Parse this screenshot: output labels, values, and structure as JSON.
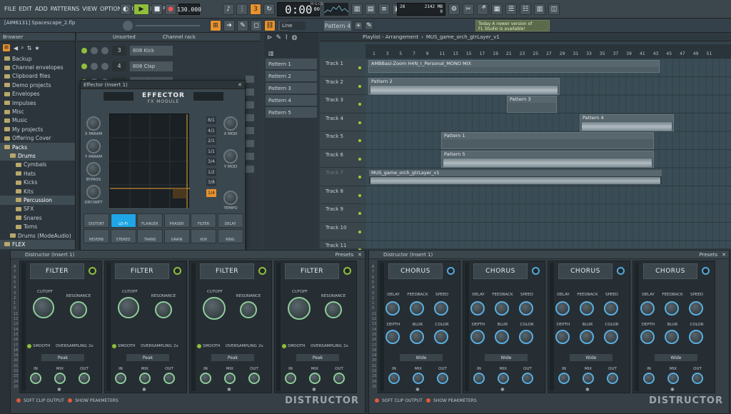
{
  "menu": [
    "FILE",
    "EDIT",
    "ADD",
    "PATTERNS",
    "VIEW",
    "OPTIONS",
    "TOOLS",
    "HELP"
  ],
  "transport": {
    "tempo": "130.000",
    "time": "0:00",
    "time_sub": "00",
    "time_unit": "M:S:CS",
    "cpu": "28",
    "mem": "2142 MB",
    "mem_sub": "0"
  },
  "hint": {
    "project": "[AIM6131] Spacescape_2.flp"
  },
  "snap": {
    "label": "Line"
  },
  "pattern_selector": "Pattern 4",
  "news": {
    "line1": "Today  A newer version of",
    "line2": "FL Studio is available!"
  },
  "browser": {
    "title": "Browser",
    "items": [
      {
        "label": "Backup",
        "level": 0
      },
      {
        "label": "Channel envelopes",
        "level": 0
      },
      {
        "label": "Clipboard files",
        "level": 0
      },
      {
        "label": "Demo projects",
        "level": 0
      },
      {
        "label": "Envelopes",
        "level": 0
      },
      {
        "label": "Impulses",
        "level": 0
      },
      {
        "label": "Misc",
        "level": 0
      },
      {
        "label": "Music",
        "level": 0
      },
      {
        "label": "My projects",
        "level": 0
      },
      {
        "label": "Offering Cover",
        "level": 0
      },
      {
        "label": "Packs",
        "level": 0,
        "sel": true
      },
      {
        "label": "Drums",
        "level": 1,
        "sel": true
      },
      {
        "label": "Cymbals",
        "level": 2
      },
      {
        "label": "Hats",
        "level": 2
      },
      {
        "label": "Kicks",
        "level": 2
      },
      {
        "label": "Kits",
        "level": 2
      },
      {
        "label": "Percussion",
        "level": 2,
        "sel": true
      },
      {
        "label": "SFX",
        "level": 2
      },
      {
        "label": "Snares",
        "level": 2
      },
      {
        "label": "Toms",
        "level": 2
      },
      {
        "label": "Drums (ModeAudio)",
        "level": 1
      },
      {
        "label": "FLEX",
        "level": 0,
        "sel": true
      }
    ]
  },
  "channel_rack": {
    "title": "Channel rack",
    "filter": "Unsorted",
    "channels": [
      {
        "num": "3",
        "name": "808 Kick"
      },
      {
        "num": "4",
        "name": "808 Clap"
      },
      {
        "num": "",
        "name": "808 HiHat"
      }
    ]
  },
  "effector": {
    "title": "Effector (Insert 1)",
    "logo1": "EFFECTOR",
    "logo2": "FX MODULE",
    "left_knobs": [
      "X PARAM",
      "Y PARAM",
      "BYPASS",
      "DRY/WET"
    ],
    "right_knobs": [
      "X MOD",
      "Y MOD",
      "TEMPO"
    ],
    "ratios": [
      "8/1",
      "4/1",
      "2/1",
      "1/1",
      "3/4",
      "1/2",
      "3/8",
      "1/4"
    ],
    "fx_row1": [
      "DISTORT",
      "LO-FI",
      "FLANGER",
      "PHASER",
      "FILTER",
      "DELAY"
    ],
    "fx_row2": [
      "REVERB",
      "STEREO",
      "TRANS",
      "GRAIN",
      "VOX",
      "RING"
    ]
  },
  "patterns": [
    "Pattern 1",
    "Pattern 2",
    "Pattern 3",
    "Pattern 4",
    "Pattern 5"
  ],
  "playlist": {
    "title": "Playlist - Arrangement",
    "path": "MUS_game_orch_gtrLayer_v1",
    "ruler": [
      "1",
      "3",
      "5",
      "7",
      "9",
      "11",
      "13",
      "15",
      "17",
      "19",
      "21",
      "23",
      "25",
      "27",
      "29",
      "31",
      "33",
      "35",
      "37",
      "39",
      "41",
      "43",
      "45",
      "47",
      "49",
      "51"
    ],
    "tracks": [
      "Track 1",
      "Track 2",
      "Track 3",
      "Track 4",
      "Track 5",
      "Track 6",
      "Track 7",
      "Track 8",
      "Track 9",
      "Track 10",
      "Track 11"
    ],
    "clips": {
      "amb": "AMBBasl-Zoom H4N_r_Personal_MONO MIX",
      "p2": "Pattern 2",
      "p3": "Pattern 3",
      "p4": "Pattern 4",
      "p1": "Pattern 1",
      "p5": "Pattern 5",
      "mus": "MUS_game_orch_gtrLayer_v1"
    }
  },
  "distructor_left": {
    "title": "Distructor (Insert 1)",
    "presets": "Presets",
    "mode": "FILTER",
    "knobs": [
      "CUTOFF",
      "RESONANCE"
    ],
    "smooth": "SMOOTH",
    "oversampling": "OVERSAMPLING",
    "os_val": "2x",
    "dropdown": "Peak",
    "io": [
      "IN",
      "MIX",
      "OUT"
    ],
    "footer1": "SOFT CLIP OUTPUT",
    "footer2": "SHOW PEAKMETERS",
    "brand": "DISTRUCTOR"
  },
  "distructor_right": {
    "title": "Distructor (Insert 1)",
    "presets": "Presets",
    "mode": "CHORUS",
    "knobs1": [
      "DELAY",
      "FEEDBACK",
      "SPEED"
    ],
    "knobs2": [
      "DEPTH",
      "BLUR",
      "COLOR"
    ],
    "dropdown": "Wide",
    "io": [
      "IN",
      "MIX",
      "OUT"
    ],
    "footer1": "SOFT CLIP OUTPUT",
    "footer2": "SHOW PEAKMETERS",
    "brand": "DISTRUCTOR"
  },
  "meter_scale": [
    "8",
    "7",
    "6",
    "5",
    "4",
    "3",
    "2",
    "1",
    "0",
    "11",
    "12",
    "13",
    "14",
    "15",
    "16",
    "17",
    "18",
    "19",
    "20",
    "21",
    "22",
    "23",
    "24",
    "25"
  ]
}
